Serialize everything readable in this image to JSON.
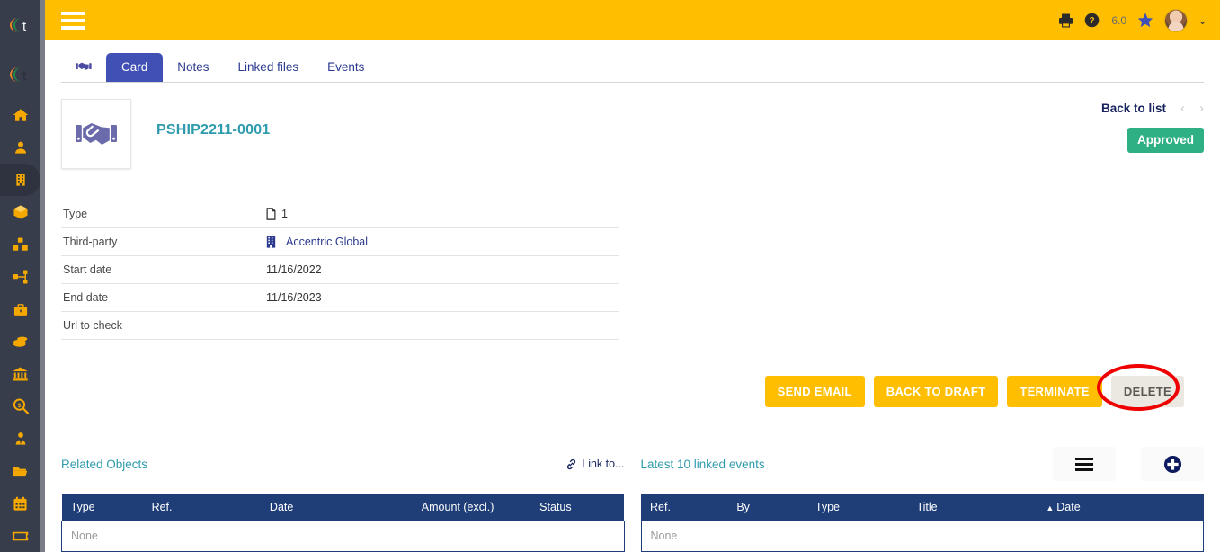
{
  "theme": {
    "header_bg": "#ffbf00",
    "sidebar_bg": "#383d4b",
    "sidebar_icon": "#f5a800",
    "accent_blue": "#4050b5",
    "title_teal": "#2e9bad",
    "status_green": "#2eaf84",
    "table_header_blue": "#1f3e78",
    "annotation_red": "#ee0000"
  },
  "sidebar": {
    "logo_name": "dolibarr-logo",
    "items": [
      {
        "name": "sidebar-item-home",
        "icon": "home-icon",
        "active": false
      },
      {
        "name": "sidebar-item-members",
        "icon": "user-icon",
        "active": false
      },
      {
        "name": "sidebar-item-thirdparties",
        "icon": "building-icon",
        "active": true
      },
      {
        "name": "sidebar-item-products",
        "icon": "box-icon",
        "active": false
      },
      {
        "name": "sidebar-item-stock",
        "icon": "boxes-icon",
        "active": false
      },
      {
        "name": "sidebar-item-mrp",
        "icon": "sitemap-icon",
        "active": false
      },
      {
        "name": "sidebar-item-commercial",
        "icon": "briefcase-icon",
        "active": false
      },
      {
        "name": "sidebar-item-billing",
        "icon": "coins-icon",
        "active": false
      },
      {
        "name": "sidebar-item-bank",
        "icon": "bank-icon",
        "active": false
      },
      {
        "name": "sidebar-item-accounting",
        "icon": "search-dollar-icon",
        "active": false
      },
      {
        "name": "sidebar-item-hrm",
        "icon": "user-tie-icon",
        "active": false
      },
      {
        "name": "sidebar-item-projects",
        "icon": "folder-open-icon",
        "active": false
      },
      {
        "name": "sidebar-item-agenda",
        "icon": "calendar-icon",
        "active": false
      },
      {
        "name": "sidebar-item-tickets",
        "icon": "ticket-icon",
        "active": false
      }
    ]
  },
  "topbar": {
    "menu_icon": "hamburger-icon",
    "print_icon": "printer-icon",
    "help_icon": "help-circle-icon",
    "version": "6.0",
    "bookmark_icon": "star-icon",
    "avatar_icon": "user-avatar",
    "dropdown_icon": "chevron-down-icon"
  },
  "tabs": {
    "leading_icon": "handshake-small-icon",
    "items": [
      {
        "label": "Card",
        "active": true
      },
      {
        "label": "Notes",
        "active": false
      },
      {
        "label": "Linked files",
        "active": false
      },
      {
        "label": "Events",
        "active": false
      }
    ]
  },
  "record": {
    "thumbnail_icon": "handshake-icon",
    "title": "PSHIP2211-0001",
    "back_to_list": "Back to list",
    "prev_icon": "chevron-left-icon",
    "next_icon": "chevron-right-icon",
    "status": "Approved",
    "fields": [
      {
        "label": "Type",
        "value": "1",
        "icon": "document-icon",
        "link": false
      },
      {
        "label": "Third-party",
        "value": "Accentric Global",
        "icon": "building-blue-icon",
        "link": true
      },
      {
        "label": "Start date",
        "value": "11/16/2022",
        "icon": null,
        "link": false
      },
      {
        "label": "End date",
        "value": "11/16/2023",
        "icon": null,
        "link": false
      },
      {
        "label": "Url to check",
        "value": "",
        "icon": null,
        "link": false
      }
    ]
  },
  "actions": [
    {
      "label": "SEND EMAIL",
      "name": "send-email-button",
      "style": "primary"
    },
    {
      "label": "BACK TO DRAFT",
      "name": "back-to-draft-button",
      "style": "primary"
    },
    {
      "label": "TERMINATE",
      "name": "terminate-button",
      "style": "primary"
    },
    {
      "label": "DELETE",
      "name": "delete-button",
      "style": "disabled",
      "annotated": true
    }
  ],
  "related_objects": {
    "title": "Related Objects",
    "link_to_label": "Link to...",
    "link_icon": "chain-link-icon",
    "columns": [
      "Type",
      "Ref.",
      "Date",
      "Amount (excl.)",
      "Status"
    ],
    "empty_text": "None"
  },
  "linked_events": {
    "title": "Latest 10 linked events",
    "list_icon": "hamburger-list-icon",
    "add_icon": "plus-circle-icon",
    "columns": [
      "Ref.",
      "By",
      "Type",
      "Title",
      "Date"
    ],
    "sorted_column": "Date",
    "sort_direction": "asc",
    "empty_text": "None"
  }
}
